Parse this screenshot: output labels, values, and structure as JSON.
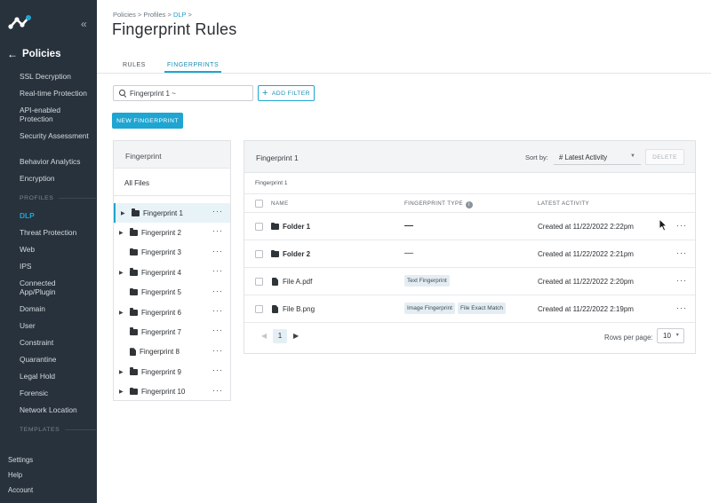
{
  "sidebar": {
    "title": "Policies",
    "nav": [
      "SSL Decryption",
      "Real-time Protection",
      "API-enabled Protection",
      "Security Assessment",
      "Behavior Analytics",
      "Encryption"
    ],
    "profiles_label": "PROFILES",
    "profiles": [
      "DLP",
      "Threat Protection",
      "Web",
      "IPS",
      "Connected App/Plugin",
      "Domain",
      "User",
      "Constraint",
      "Quarantine",
      "Legal Hold",
      "Forensic",
      "Network Location"
    ],
    "templates_label": "TEMPLATES",
    "footer": [
      "Settings",
      "Help",
      "Account"
    ]
  },
  "breadcrumb": {
    "part1": "Policies > Profiles > ",
    "link": "DLP",
    "suffix": " >"
  },
  "page_title": "Fingerprint Rules",
  "tabs": {
    "rules": "RULES",
    "fingerprints": "FINGERPRINTS"
  },
  "search": {
    "value": "Fingerprint 1 ~"
  },
  "add_filter_label": "ADD FILTER",
  "new_fingerprint_label": "NEW FINGERPRINT",
  "tree": {
    "header": "Fingerprint",
    "all_files": "All Files",
    "items": [
      {
        "label": "Fingerprint 1",
        "icon": "folder"
      },
      {
        "label": "Fingerprint 2",
        "icon": "folder"
      },
      {
        "label": "Fingerprint 3",
        "icon": "folder"
      },
      {
        "label": "Fingerprint 4",
        "icon": "folder"
      },
      {
        "label": "Fingerprint 5",
        "icon": "folder"
      },
      {
        "label": "Fingerprint 6",
        "icon": "folder"
      },
      {
        "label": "Fingerprint 7",
        "icon": "folder"
      },
      {
        "label": "Fingerprint 8",
        "icon": "file"
      },
      {
        "label": "Fingerprint 9",
        "icon": "folder"
      },
      {
        "label": "Fingerprint 10",
        "icon": "folder"
      }
    ],
    "more": "···"
  },
  "panel": {
    "title": "Fingerprint 1",
    "sort_label": "Sort by:",
    "sort_value": "# Latest Activity",
    "delete_label": "DELETE",
    "crumb": "Fingerprint 1",
    "columns": {
      "name": "NAME",
      "type": "FINGERPRINT TYPE",
      "activity": "LATEST ACTIVITY"
    },
    "rows": [
      {
        "name": "Folder 1",
        "dash": "—",
        "date": "Created at 11/22/2022 2:22pm"
      },
      {
        "name": "Folder 2",
        "dash": "—",
        "date": "Created at 11/22/2022 2:21pm"
      },
      {
        "name": "File A.pdf",
        "tag1": "Text Fingerprint",
        "date": "Created at 11/22/2022 2:20pm"
      },
      {
        "name": "File B.png",
        "tag1": "Image Fingerprint",
        "tag2": "File Exact Match",
        "date": "Created at 11/22/2022 2:19pm"
      }
    ],
    "page": "1",
    "rows_per_page_label": "Rows per page:",
    "rows_per_page": "10"
  },
  "colors": {
    "accent": "#1fa5d1",
    "sidebar_bg": "#28323c"
  }
}
